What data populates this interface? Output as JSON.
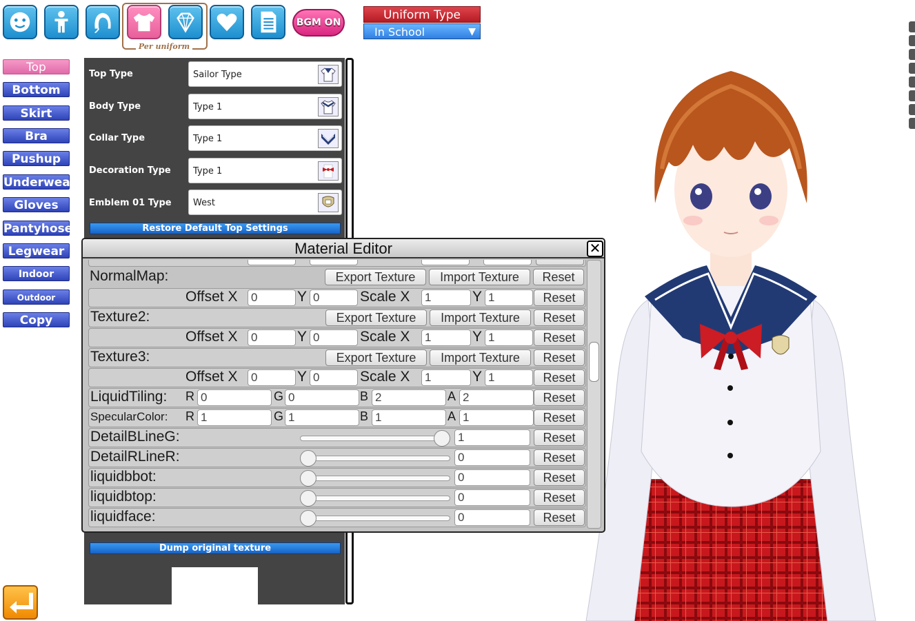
{
  "toolbar": {
    "per_uniform_label": "Per uniform",
    "bgm_label": "BGM ON",
    "buttons": [
      {
        "icon": "face-icon"
      },
      {
        "icon": "body-icon"
      },
      {
        "icon": "hair-icon"
      },
      {
        "icon": "clothing-icon",
        "active": true
      },
      {
        "icon": "accessory-icon"
      },
      {
        "icon": "heart-icon"
      },
      {
        "icon": "document-icon"
      }
    ]
  },
  "uniform_type": {
    "title": "Uniform Type",
    "selected": "In School",
    "arrow": "▼"
  },
  "categories": [
    "Top",
    "Bottom",
    "Skirt Scale",
    "Bra",
    "Pushup",
    "Underwear",
    "Gloves",
    "Pantyhose",
    "Legwear",
    "Indoor Shoes",
    "Outdoor Shoes",
    "Copy"
  ],
  "active_category": "Top",
  "settings": [
    {
      "label": "Top Type",
      "value": "Sailor Type"
    },
    {
      "label": "Body Type",
      "value": "Type 1"
    },
    {
      "label": "Collar Type",
      "value": "Type 1"
    },
    {
      "label": "Decoration Type",
      "value": "Type 1"
    },
    {
      "label": "Emblem 01 Type",
      "value": "West"
    }
  ],
  "restore_label": "Restore Default Top Settings",
  "dump_label": "Dump original texture",
  "material_editor": {
    "title": "Material Editor",
    "close": "✕",
    "export_label": "Export Texture",
    "import_label": "Import Texture",
    "reset_label": "Reset",
    "offset_x_label": "Offset X",
    "y_label": "Y",
    "scale_x_label": "Scale X",
    "textures": [
      {
        "name": "NormalMap:",
        "offset_x": "0",
        "offset_y": "0",
        "scale_x": "1",
        "scale_y": "1"
      },
      {
        "name": "Texture2:",
        "offset_x": "0",
        "offset_y": "0",
        "scale_x": "1",
        "scale_y": "1"
      },
      {
        "name": "Texture3:",
        "offset_x": "0",
        "offset_y": "0",
        "scale_x": "1",
        "scale_y": "1"
      }
    ],
    "colors": [
      {
        "name": "LiquidTiling:",
        "r": "0",
        "g": "0",
        "b": "2",
        "a": "2"
      },
      {
        "name": "SpecularColor:",
        "r": "1",
        "g": "1",
        "b": "1",
        "a": "1"
      }
    ],
    "channel_labels": {
      "r": "R",
      "g": "G",
      "b": "B",
      "a": "A"
    },
    "sliders": [
      {
        "name": "DetailBLineG:",
        "value": "1",
        "level": 1
      },
      {
        "name": "DetailRLineR:",
        "value": "0",
        "level": 0
      },
      {
        "name": "liquidbbot:",
        "value": "0",
        "level": 0
      },
      {
        "name": "liquidbtop:",
        "value": "0",
        "level": 0
      },
      {
        "name": "liquidface:",
        "value": "0",
        "level": 0
      }
    ]
  },
  "colors": {
    "accent_pink": "#e85f9b",
    "accent_blue": "#2e43b8",
    "bar_blue": "#1663c8"
  }
}
